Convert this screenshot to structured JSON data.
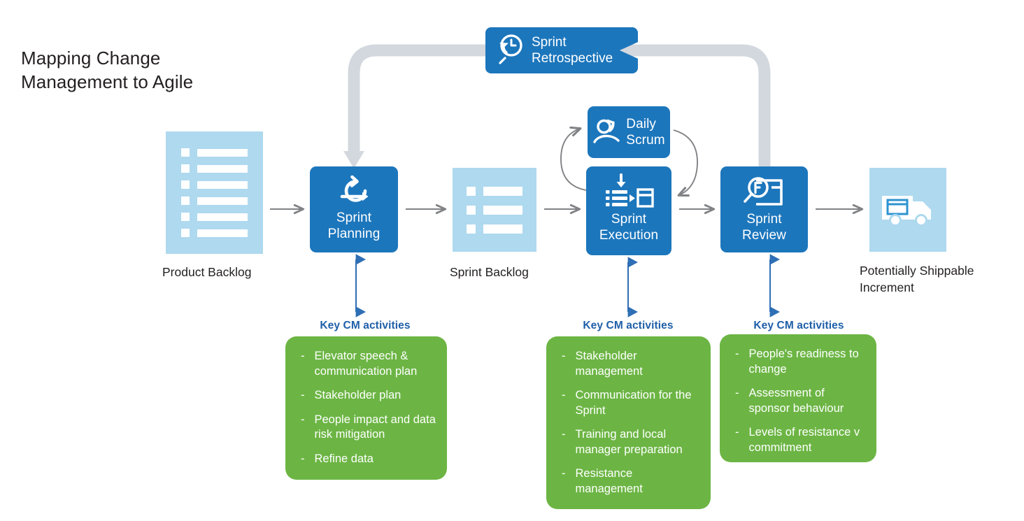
{
  "title": "Mapping Change\nManagement to Agile",
  "colors": {
    "process_blue": "#1c76bc",
    "artifact_blue": "#aed9ef",
    "activity_green": "#6cb544",
    "heading_blue": "#1f5fa9",
    "connector_gray": "#d3d8de",
    "arrow_gray": "#808285",
    "text_dark": "#231f20"
  },
  "artifacts": {
    "product_backlog": {
      "label": "Product Backlog",
      "icon": "document-list-icon",
      "rows": 6
    },
    "sprint_backlog": {
      "label": "Sprint Backlog",
      "icon": "list-icon",
      "rows": 3
    },
    "increment": {
      "label": "Potentially Shippable\nIncrement",
      "icon": "delivery-truck-icon"
    }
  },
  "process": {
    "sprint_planning": {
      "label": "Sprint\nPlanning",
      "icon": "refresh-cycle-arrow-icon"
    },
    "sprint_execution": {
      "label": "Sprint\nExecution",
      "icon": "list-to-board-icon"
    },
    "sprint_review": {
      "label": "Sprint\nReview",
      "icon": "magnifier-presentation-icon"
    },
    "daily_scrum": {
      "label": "Daily\nScrum",
      "icon": "person-refresh-icon"
    },
    "sprint_retrospective": {
      "label": "Sprint\nRetrospective",
      "icon": "clock-rewind-magnifier-icon"
    }
  },
  "cm_sections": [
    {
      "heading": "Key CM activities",
      "bullet_marker": "-",
      "items": [
        "Elevator speech & communication plan",
        "Stakeholder plan",
        "People impact and data risk mitigation",
        "Refine data"
      ]
    },
    {
      "heading": "Key CM activities",
      "bullet_marker": "-",
      "items": [
        "Stakeholder management",
        "Communication for the Sprint",
        "Training and local manager preparation",
        "Resistance management"
      ]
    },
    {
      "heading": "Key CM activities",
      "bullet_marker": "-",
      "items": [
        "People's readiness to change",
        "Assessment of sponsor behaviour",
        "Levels of resistance v commitment"
      ]
    }
  ]
}
